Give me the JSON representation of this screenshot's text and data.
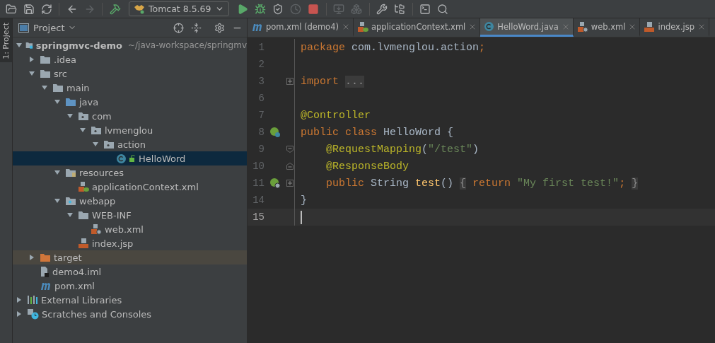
{
  "toolbar": {
    "buttons": [
      {
        "kind": "open",
        "disabled": false
      },
      {
        "kind": "save",
        "disabled": false
      },
      {
        "kind": "sync",
        "disabled": false
      },
      {
        "kind": "back",
        "disabled": false
      },
      {
        "kind": "forward",
        "disabled": true
      },
      {
        "kind": "build",
        "disabled": false
      },
      {
        "kind": "run-config"
      },
      {
        "kind": "run",
        "disabled": false
      },
      {
        "kind": "debug",
        "disabled": false
      },
      {
        "kind": "coverage",
        "disabled": false
      },
      {
        "kind": "profile",
        "disabled": true
      },
      {
        "kind": "stop",
        "disabled": false
      },
      {
        "kind": "attach",
        "disabled": true
      },
      {
        "kind": "update",
        "disabled": true
      },
      {
        "kind": "settings",
        "disabled": false
      },
      {
        "kind": "structure",
        "disabled": false
      },
      {
        "kind": "terminal",
        "disabled": false
      },
      {
        "kind": "search",
        "disabled": false
      }
    ],
    "run_config": "Tomcat 8.5.69"
  },
  "side_strip": {
    "label": "1: Project"
  },
  "project_panel": {
    "title": "Project",
    "tree": [
      {
        "label": "springmvc-demo",
        "hint": "~/java-workspace/springmv",
        "kind": "module",
        "expanded": true,
        "selected": false,
        "hovered": false,
        "children": [
          {
            "label": ".idea",
            "kind": "folder",
            "expanded": false,
            "selected": false,
            "hovered": false
          },
          {
            "label": "src",
            "kind": "folder",
            "expanded": true,
            "selected": false,
            "hovered": false,
            "children": [
              {
                "label": "main",
                "kind": "folder",
                "expanded": true,
                "selected": false,
                "hovered": false,
                "children": [
                  {
                    "label": "java",
                    "kind": "source-folder",
                    "expanded": true,
                    "selected": false,
                    "hovered": false,
                    "children": [
                      {
                        "label": "com",
                        "kind": "package",
                        "expanded": true,
                        "selected": false,
                        "hovered": false,
                        "children": [
                          {
                            "label": "lvmenglou",
                            "kind": "package",
                            "expanded": true,
                            "selected": false,
                            "hovered": false,
                            "children": [
                              {
                                "label": "action",
                                "kind": "package",
                                "expanded": true,
                                "selected": false,
                                "hovered": false,
                                "children": [
                                  {
                                    "label": "HelloWord",
                                    "kind": "class",
                                    "selected": true,
                                    "hovered": false
                                  }
                                ]
                              }
                            ]
                          }
                        ]
                      }
                    ]
                  },
                  {
                    "label": "resources",
                    "kind": "resources",
                    "expanded": true,
                    "selected": false,
                    "hovered": false,
                    "children": [
                      {
                        "label": "applicationContext.xml",
                        "kind": "spring-xml",
                        "selected": false,
                        "hovered": false
                      }
                    ]
                  },
                  {
                    "label": "webapp",
                    "kind": "web-folder",
                    "expanded": true,
                    "selected": false,
                    "hovered": false,
                    "children": [
                      {
                        "label": "WEB-INF",
                        "kind": "folder",
                        "expanded": true,
                        "selected": false,
                        "hovered": false,
                        "children": [
                          {
                            "label": "web.xml",
                            "kind": "web-xml",
                            "selected": false,
                            "hovered": false
                          }
                        ]
                      },
                      {
                        "label": "index.jsp",
                        "kind": "jsp",
                        "selected": false,
                        "hovered": false
                      }
                    ]
                  }
                ]
              }
            ]
          },
          {
            "label": "target",
            "kind": "excluded-folder",
            "expanded": false,
            "selected": false,
            "hovered": true
          },
          {
            "label": "demo4.iml",
            "kind": "iml",
            "selected": false,
            "hovered": false
          },
          {
            "label": "pom.xml",
            "kind": "maven",
            "selected": false,
            "hovered": false
          }
        ]
      },
      {
        "label": "External Libraries",
        "kind": "libraries",
        "expanded": false,
        "selected": false,
        "hovered": false
      },
      {
        "label": "Scratches and Consoles",
        "kind": "scratches",
        "expanded": false,
        "selected": false,
        "hovered": false
      }
    ]
  },
  "editor": {
    "tabs": [
      {
        "label": "pom.xml (demo4)",
        "kind": "maven",
        "selected": false
      },
      {
        "label": "applicationContext.xml",
        "kind": "spring-xml",
        "selected": false
      },
      {
        "label": "HelloWord.java",
        "kind": "class",
        "selected": true
      },
      {
        "label": "web.xml",
        "kind": "web-xml",
        "selected": false
      },
      {
        "label": "index.jsp",
        "kind": "jsp",
        "selected": false
      }
    ],
    "lines": [
      {
        "number": "1",
        "current": false,
        "indented": false,
        "tokens": [
          {
            "kind": "keyword",
            "text": "package"
          },
          {
            "kind": "plain",
            "text": " com.lvmenglou.action"
          },
          {
            "kind": "keyword",
            "text": ";"
          }
        ]
      },
      {
        "number": "2",
        "current": false
      },
      {
        "number": "3",
        "current": false,
        "indented": false,
        "fold": {
          "kind": "plus"
        },
        "tokens": [
          {
            "kind": "keyword",
            "text": "import "
          },
          {
            "kind": "folded",
            "text": "..."
          }
        ]
      },
      {
        "number": "6",
        "current": false
      },
      {
        "number": "7",
        "current": false,
        "indented": false,
        "tokens": [
          {
            "kind": "annotation",
            "text": "@Controller"
          }
        ]
      },
      {
        "number": "8",
        "current": false,
        "indented": false,
        "marker": {
          "kind": "bean"
        },
        "tokens": [
          {
            "kind": "keyword",
            "text": "public class "
          },
          {
            "kind": "plain",
            "text": "HelloWord {"
          }
        ]
      },
      {
        "number": "9",
        "current": false,
        "indented": true,
        "fold": {
          "kind": "start"
        },
        "tokens": [
          {
            "kind": "annotation",
            "text": "@RequestMapping"
          },
          {
            "kind": "plain",
            "text": "("
          },
          {
            "kind": "string",
            "text": "\"/test\""
          },
          {
            "kind": "plain",
            "text": ")"
          }
        ]
      },
      {
        "number": "10",
        "current": false,
        "indented": true,
        "fold": {
          "kind": "end"
        },
        "tokens": [
          {
            "kind": "annotation",
            "text": "@ResponseBody"
          }
        ]
      },
      {
        "number": "11",
        "current": false,
        "indented": true,
        "fold": {
          "kind": "plus"
        },
        "marker": {
          "kind": "web"
        },
        "tokens": [
          {
            "kind": "keyword",
            "text": "public "
          },
          {
            "kind": "plain",
            "text": "String "
          },
          {
            "kind": "method",
            "text": "test"
          },
          {
            "kind": "plain",
            "text": "() "
          },
          {
            "kind": "folded",
            "text": "{"
          },
          {
            "kind": "keyword",
            "text": " return "
          },
          {
            "kind": "string",
            "text": "\"My first test!\""
          },
          {
            "kind": "keyword",
            "text": "; "
          },
          {
            "kind": "folded",
            "text": "}"
          }
        ]
      },
      {
        "number": "14",
        "current": false,
        "indented": false,
        "tokens": [
          {
            "kind": "plain",
            "text": "}"
          }
        ]
      },
      {
        "number": "15",
        "current": true,
        "indented": false
      }
    ]
  }
}
